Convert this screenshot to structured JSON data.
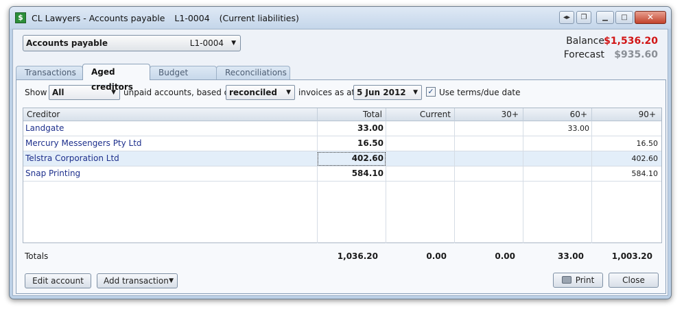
{
  "window": {
    "app_name": "CL Lawyers - Accounts payable",
    "account_code": "L1-0004",
    "account_type": "(Current liabilities)"
  },
  "account_select": {
    "name": "Accounts payable",
    "code": "L1-0004"
  },
  "balance": {
    "label": "Balance",
    "value": "$1,536.20"
  },
  "forecast": {
    "label": "Forecast",
    "value": "$935.60"
  },
  "tabs": [
    {
      "label": "Transactions",
      "active": false
    },
    {
      "label": "Aged creditors",
      "active": true
    },
    {
      "label": "Budget",
      "active": false
    },
    {
      "label": "Reconciliations",
      "active": false
    }
  ],
  "filters": {
    "show_label": "Show",
    "show_value": "All",
    "unpaid_label": "unpaid accounts, based on",
    "based_value": "reconciled",
    "invoices_label": "invoices as at",
    "date_value": "5 Jun 2012",
    "terms_label": "Use terms/due date",
    "terms_checked": true
  },
  "grid": {
    "columns": [
      "Creditor",
      "Total",
      "Current",
      "30+",
      "60+",
      "90+"
    ],
    "rows": [
      {
        "creditor": "Landgate",
        "total": "33.00",
        "current": "",
        "d30": "",
        "d60": "33.00",
        "d90": ""
      },
      {
        "creditor": "Mercury Messengers Pty Ltd",
        "total": "16.50",
        "current": "",
        "d30": "",
        "d60": "",
        "d90": "16.50"
      },
      {
        "creditor": "Telstra Corporation Ltd",
        "total": "402.60",
        "current": "",
        "d30": "",
        "d60": "",
        "d90": "402.60"
      },
      {
        "creditor": "Snap Printing",
        "total": "584.10",
        "current": "",
        "d30": "",
        "d60": "",
        "d90": "584.10"
      }
    ]
  },
  "totals": {
    "label": "Totals",
    "total": "1,036.20",
    "current": "0.00",
    "d30": "0.00",
    "d60": "33.00",
    "d90": "1,003.20"
  },
  "buttons": {
    "edit_account": "Edit account",
    "add_transaction": "Add transaction",
    "print": "Print",
    "close": "Close"
  }
}
